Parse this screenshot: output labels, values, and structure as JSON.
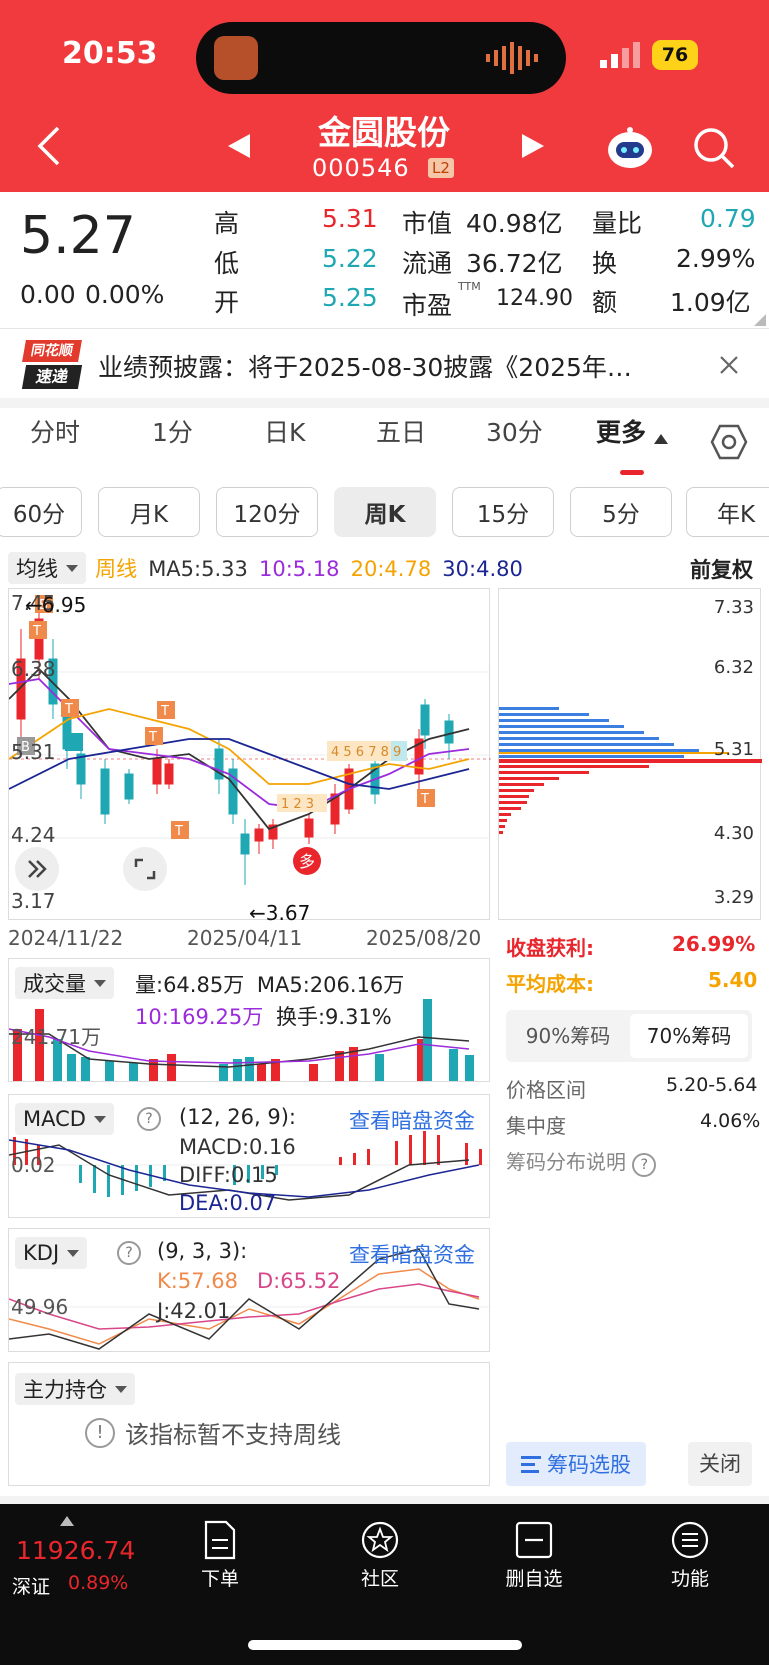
{
  "status": {
    "time": "20:53",
    "battery": "76"
  },
  "header": {
    "name": "金圆股份",
    "code": "000546",
    "badge": "L2"
  },
  "quote": {
    "price": "5.27",
    "change": "0.00",
    "change_pct": "0.00%",
    "high_l": "高",
    "high": "5.31",
    "low_l": "低",
    "low": "5.22",
    "open_l": "开",
    "open": "5.25",
    "mcap_l": "市值",
    "mcap": "40.98亿",
    "float_l": "流通",
    "float": "36.72亿",
    "pe_l": "市盈",
    "pe_sup": "TTM",
    "pe": "124.90",
    "vr_l": "量比",
    "vr": "0.79",
    "turn_l": "换",
    "turn": "2.99%",
    "amt_l": "额",
    "amt": "1.09亿"
  },
  "notice": {
    "logo1": "同花顺",
    "logo2": "速递",
    "text": "业绩预披露：将于2025-08-30披露《2025年…"
  },
  "tabs": [
    "分时",
    "1分",
    "日K",
    "五日",
    "30分",
    "更多"
  ],
  "subtabs": [
    "60分",
    "月K",
    "120分",
    "周K",
    "15分",
    "5分",
    "年K"
  ],
  "ma": {
    "sel": "均线",
    "label": "周线",
    "ma5": "MA5:5.33",
    "ma10": "10:5.18",
    "ma20": "20:4.78",
    "ma30": "30:4.80",
    "adj": "前复权"
  },
  "kline": {
    "y_top": "7.45",
    "max": "←6.95",
    "y2": "6.38",
    "y3": "5.31",
    "y4": "4.24",
    "y5": "3.17",
    "min": "←3.67",
    "dates": [
      "2024/11/22",
      "2025/04/11",
      "2025/08/20"
    ],
    "duo": "多",
    "seq_up": "1 2 3",
    "seq_dn": "4 5 6 7 8 9"
  },
  "chip": {
    "y": [
      "7.33",
      "6.32",
      "5.31",
      "4.30",
      "3.29"
    ],
    "profit_l": "收盘获利:",
    "profit": "26.99%",
    "cost_l": "平均成本:",
    "cost": "5.40",
    "tab1": "90%筹码",
    "tab2": "70%筹码",
    "range_l": "价格区间",
    "range": "5.20-5.64",
    "conc_l": "集中度",
    "conc": "4.06%",
    "explain": "筹码分布说明",
    "pick": "筹码选股",
    "close": "关闭"
  },
  "volume": {
    "sel": "成交量",
    "vol": "量:64.85万",
    "ma5": "MA5:206.16万",
    "ma10": "10:169.25万",
    "hs": "换手:9.31%",
    "axis": "241.71万"
  },
  "macd": {
    "sel": "MACD",
    "params": "(12, 26, 9):",
    "link": "查看暗盘资金",
    "macd": "MACD:0.16",
    "diff": "DIFF:0.15",
    "dea": "DEA:0.07",
    "axis": "0.02"
  },
  "kdj": {
    "sel": "KDJ",
    "params": "(9, 3, 3):",
    "link": "查看暗盘资金",
    "k": "K:57.68",
    "d": "D:65.52",
    "j": "J:42.01",
    "axis": "49.96"
  },
  "main_hold": {
    "sel": "主力持仓",
    "msg": "该指标暂不支持周线"
  },
  "bottom": {
    "index": "11926.74",
    "market": "深证",
    "index_pct": "0.89%",
    "nav": [
      "下单",
      "社区",
      "删自选",
      "功能"
    ]
  }
}
